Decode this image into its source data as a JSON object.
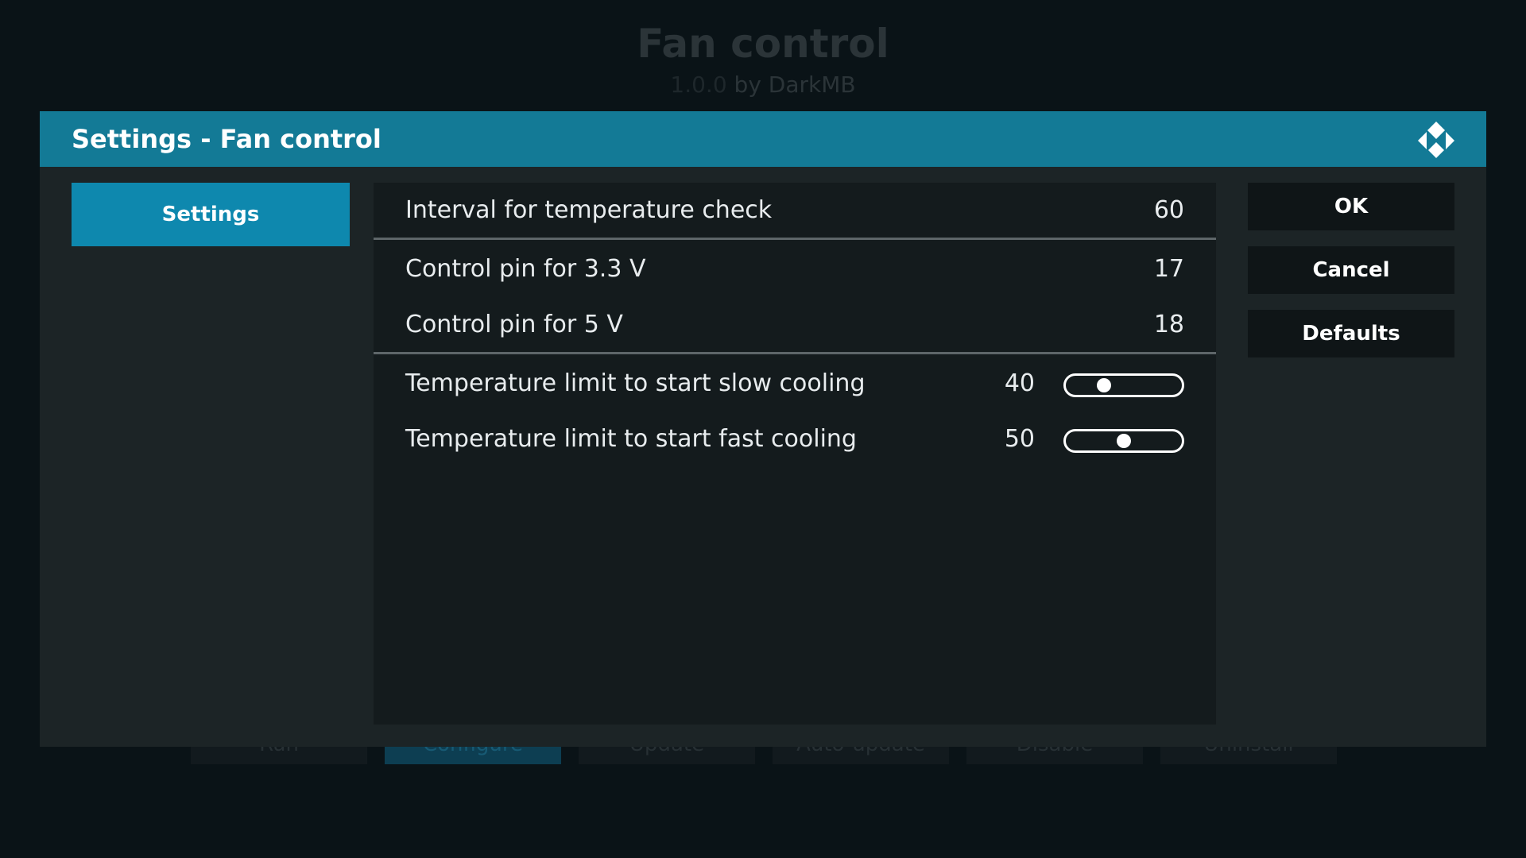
{
  "background": {
    "addon_name": "Fan control",
    "version": "1.0.0",
    "author_text": "by DarkMB",
    "buttons": [
      {
        "label": "Run",
        "active": false
      },
      {
        "label": "Configure",
        "active": true
      },
      {
        "label": "Update",
        "active": false
      },
      {
        "label": "Auto-update",
        "active": false
      },
      {
        "label": "Disable",
        "active": false
      },
      {
        "label": "Uninstall",
        "active": false
      }
    ]
  },
  "dialog": {
    "title": "Settings - Fan control",
    "logo_icon": "kodi-logo-icon",
    "header_color": "#137a96",
    "categories": [
      {
        "label": "Settings",
        "selected": true
      }
    ],
    "settings": [
      {
        "label": "Interval for temperature check",
        "value": "60"
      },
      {
        "label": "Control pin for 3.3 V",
        "value": "17"
      },
      {
        "label": "Control pin for 5 V",
        "value": "18"
      },
      {
        "label": "Temperature limit to start slow cooling",
        "value": "40",
        "slider_fraction": 0.33
      },
      {
        "label": "Temperature limit to start fast cooling",
        "value": "50",
        "slider_fraction": 0.5
      }
    ],
    "actions": {
      "ok": "OK",
      "cancel": "Cancel",
      "defaults": "Defaults"
    },
    "accent_color": "#0e88ae"
  }
}
